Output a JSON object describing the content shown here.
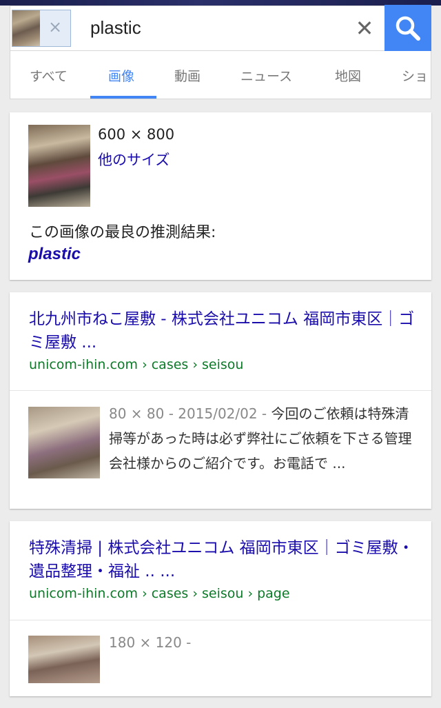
{
  "search": {
    "query": "plastic",
    "chip_remove_glyph": "×",
    "clear_glyph": "✕"
  },
  "tabs": [
    {
      "label": "すべて"
    },
    {
      "label": "画像"
    },
    {
      "label": "動画"
    },
    {
      "label": "ニュース"
    },
    {
      "label": "地図"
    },
    {
      "label": "ショ"
    }
  ],
  "colors": {
    "accent": "#4285f4",
    "link": "#1a0dab",
    "url": "#0b7a27"
  },
  "image_info": {
    "dimensions": "600 × 800",
    "other_sizes": "他のサイズ",
    "best_guess_label": "この画像の最良の推測結果:",
    "best_guess_query": "plastic"
  },
  "results": [
    {
      "title": "北九州市ねこ屋敷 - 株式会社ユニコム 福岡市東区｜ゴミ屋敷 ...",
      "url": "unicom-ihin.com › cases › seisou",
      "meta": "80 × 80 - 2015/02/02 - ",
      "snippet": "今回のご依頼は特殊清掃等があった時は必ず弊社にご依頼を下さる管理会社様からのご紹介です。お電話で ..."
    },
    {
      "title": "特殊清掃 | 株式会社ユニコム 福岡市東区｜ゴミ屋敷・遺品整理・福祉 .. ...",
      "url": "unicom-ihin.com › cases › seisou › page",
      "meta": "180 × 120 - ",
      "snippet": ""
    }
  ]
}
